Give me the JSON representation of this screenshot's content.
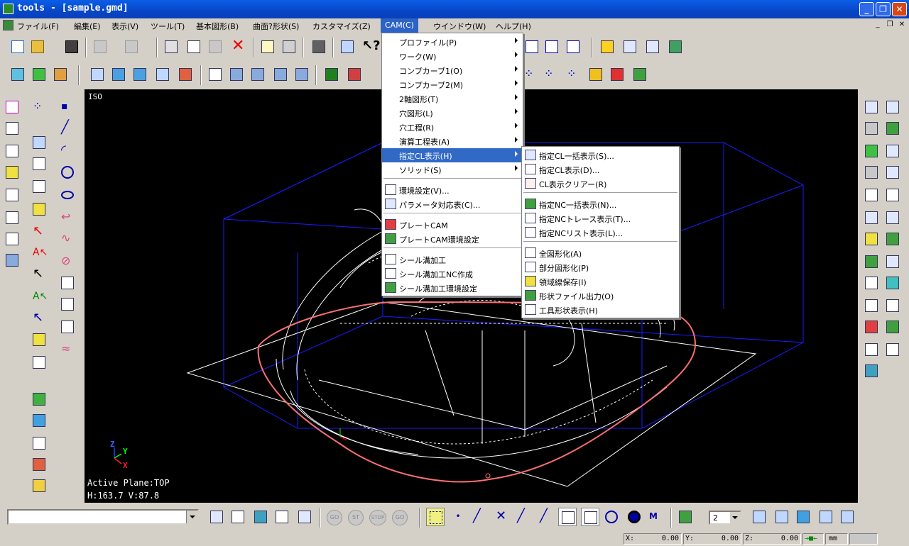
{
  "window": {
    "title": "tools - [sample.gmd]"
  },
  "menubar": {
    "items": [
      {
        "label": "ファイル(F)"
      },
      {
        "label": "編集(E)"
      },
      {
        "label": "表示(V)"
      },
      {
        "label": "ツール(T)"
      },
      {
        "label": "基本図形(B)"
      },
      {
        "label": "曲面?形状(S)"
      },
      {
        "label": "カスタマイズ(Z)"
      },
      {
        "label": "CAM(C)"
      },
      {
        "label": "ウインドウ(W)"
      },
      {
        "label": "ヘルプ(H)"
      }
    ]
  },
  "cam_menu": {
    "items": [
      {
        "label": "プロファイル(P)"
      },
      {
        "label": "ワーク(W)"
      },
      {
        "label": "コンプカーブ1(O)"
      },
      {
        "label": "コンプカーブ2(M)"
      },
      {
        "label": "2軸図形(T)"
      },
      {
        "label": "穴図形(L)"
      },
      {
        "label": "穴工程(R)"
      },
      {
        "label": "演算工程表(A)"
      },
      {
        "label": "指定CL表示(H)"
      },
      {
        "label": "ソリッド(S)"
      },
      {
        "label": "環境設定(V)..."
      },
      {
        "label": "パラメータ対応表(C)..."
      },
      {
        "label": "プレートCAM"
      },
      {
        "label": "プレートCAM環境設定"
      },
      {
        "label": "シール溝加工"
      },
      {
        "label": "シール溝加工NC作成"
      },
      {
        "label": "シール溝加工環境設定"
      }
    ]
  },
  "cl_submenu": {
    "items": [
      {
        "label": "指定CL一括表示(S)..."
      },
      {
        "label": "指定CL表示(D)..."
      },
      {
        "label": "CL表示クリアー(R)"
      },
      {
        "label": "指定NC一括表示(N)..."
      },
      {
        "label": "指定NCトレース表示(T)..."
      },
      {
        "label": "指定NCリスト表示(L)..."
      },
      {
        "label": "全図形化(A)"
      },
      {
        "label": "部分図形化(P)"
      },
      {
        "label": "領域線保存(I)"
      },
      {
        "label": "形状ファイル出力(O)"
      },
      {
        "label": "工具形状表示(H)"
      }
    ]
  },
  "viewport": {
    "view_label": "ISO",
    "active_plane": "Active Plane:TOP",
    "hv": "H:163.7  V:87.8",
    "axis_z": "Z",
    "axis_y": "Y",
    "axis_x": "X"
  },
  "bottombar": {
    "dropdown_value": "",
    "go1": "GO",
    "st": "ST",
    "stop": "STOP",
    "go2": "GO",
    "layer_value": "2"
  },
  "statusbar": {
    "x_label": "X:",
    "x_value": "0.00",
    "y_label": "Y:",
    "y_value": "0.00",
    "z_label": "Z:",
    "z_value": "0.00",
    "unit": "mm"
  },
  "colors": {
    "menu_highlight": "#316ac5",
    "viewport_bg": "#000000",
    "path_red": "#ff6a6a",
    "grid_blue": "#1a1aff"
  }
}
